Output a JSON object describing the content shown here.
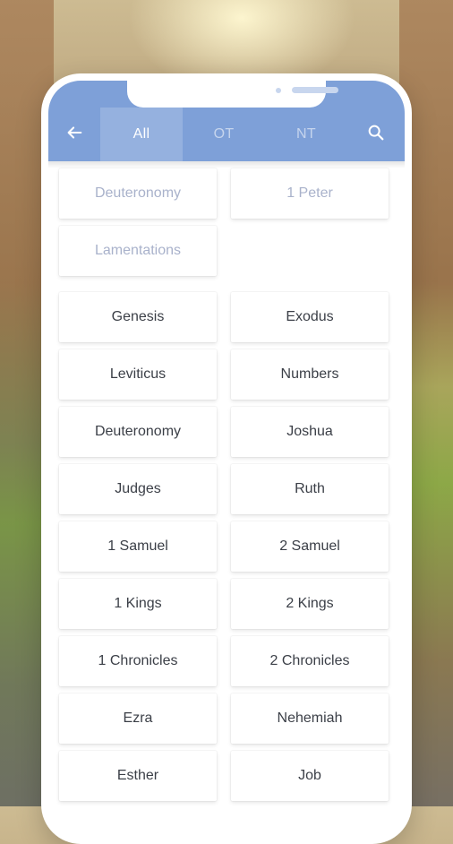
{
  "header": {
    "tabs": [
      {
        "label": "All"
      },
      {
        "label": "OT"
      },
      {
        "label": "NT"
      }
    ]
  },
  "recent": [
    {
      "label": "Deuteronomy"
    },
    {
      "label": "1 Peter"
    },
    {
      "label": "Lamentations"
    }
  ],
  "books": [
    {
      "label": "Genesis"
    },
    {
      "label": "Exodus"
    },
    {
      "label": "Leviticus"
    },
    {
      "label": "Numbers"
    },
    {
      "label": "Deuteronomy"
    },
    {
      "label": "Joshua"
    },
    {
      "label": "Judges"
    },
    {
      "label": "Ruth"
    },
    {
      "label": "1 Samuel"
    },
    {
      "label": "2 Samuel"
    },
    {
      "label": "1 Kings"
    },
    {
      "label": "2 Kings"
    },
    {
      "label": "1 Chronicles"
    },
    {
      "label": "2 Chronicles"
    },
    {
      "label": "Ezra"
    },
    {
      "label": "Nehemiah"
    },
    {
      "label": "Esther"
    },
    {
      "label": "Job"
    }
  ],
  "icons": {
    "back": "arrow-left-icon",
    "search": "search-icon"
  },
  "colors": {
    "accent": "#7ea0d8",
    "muted_text": "#a9b2cb",
    "text": "#3b3f47"
  }
}
